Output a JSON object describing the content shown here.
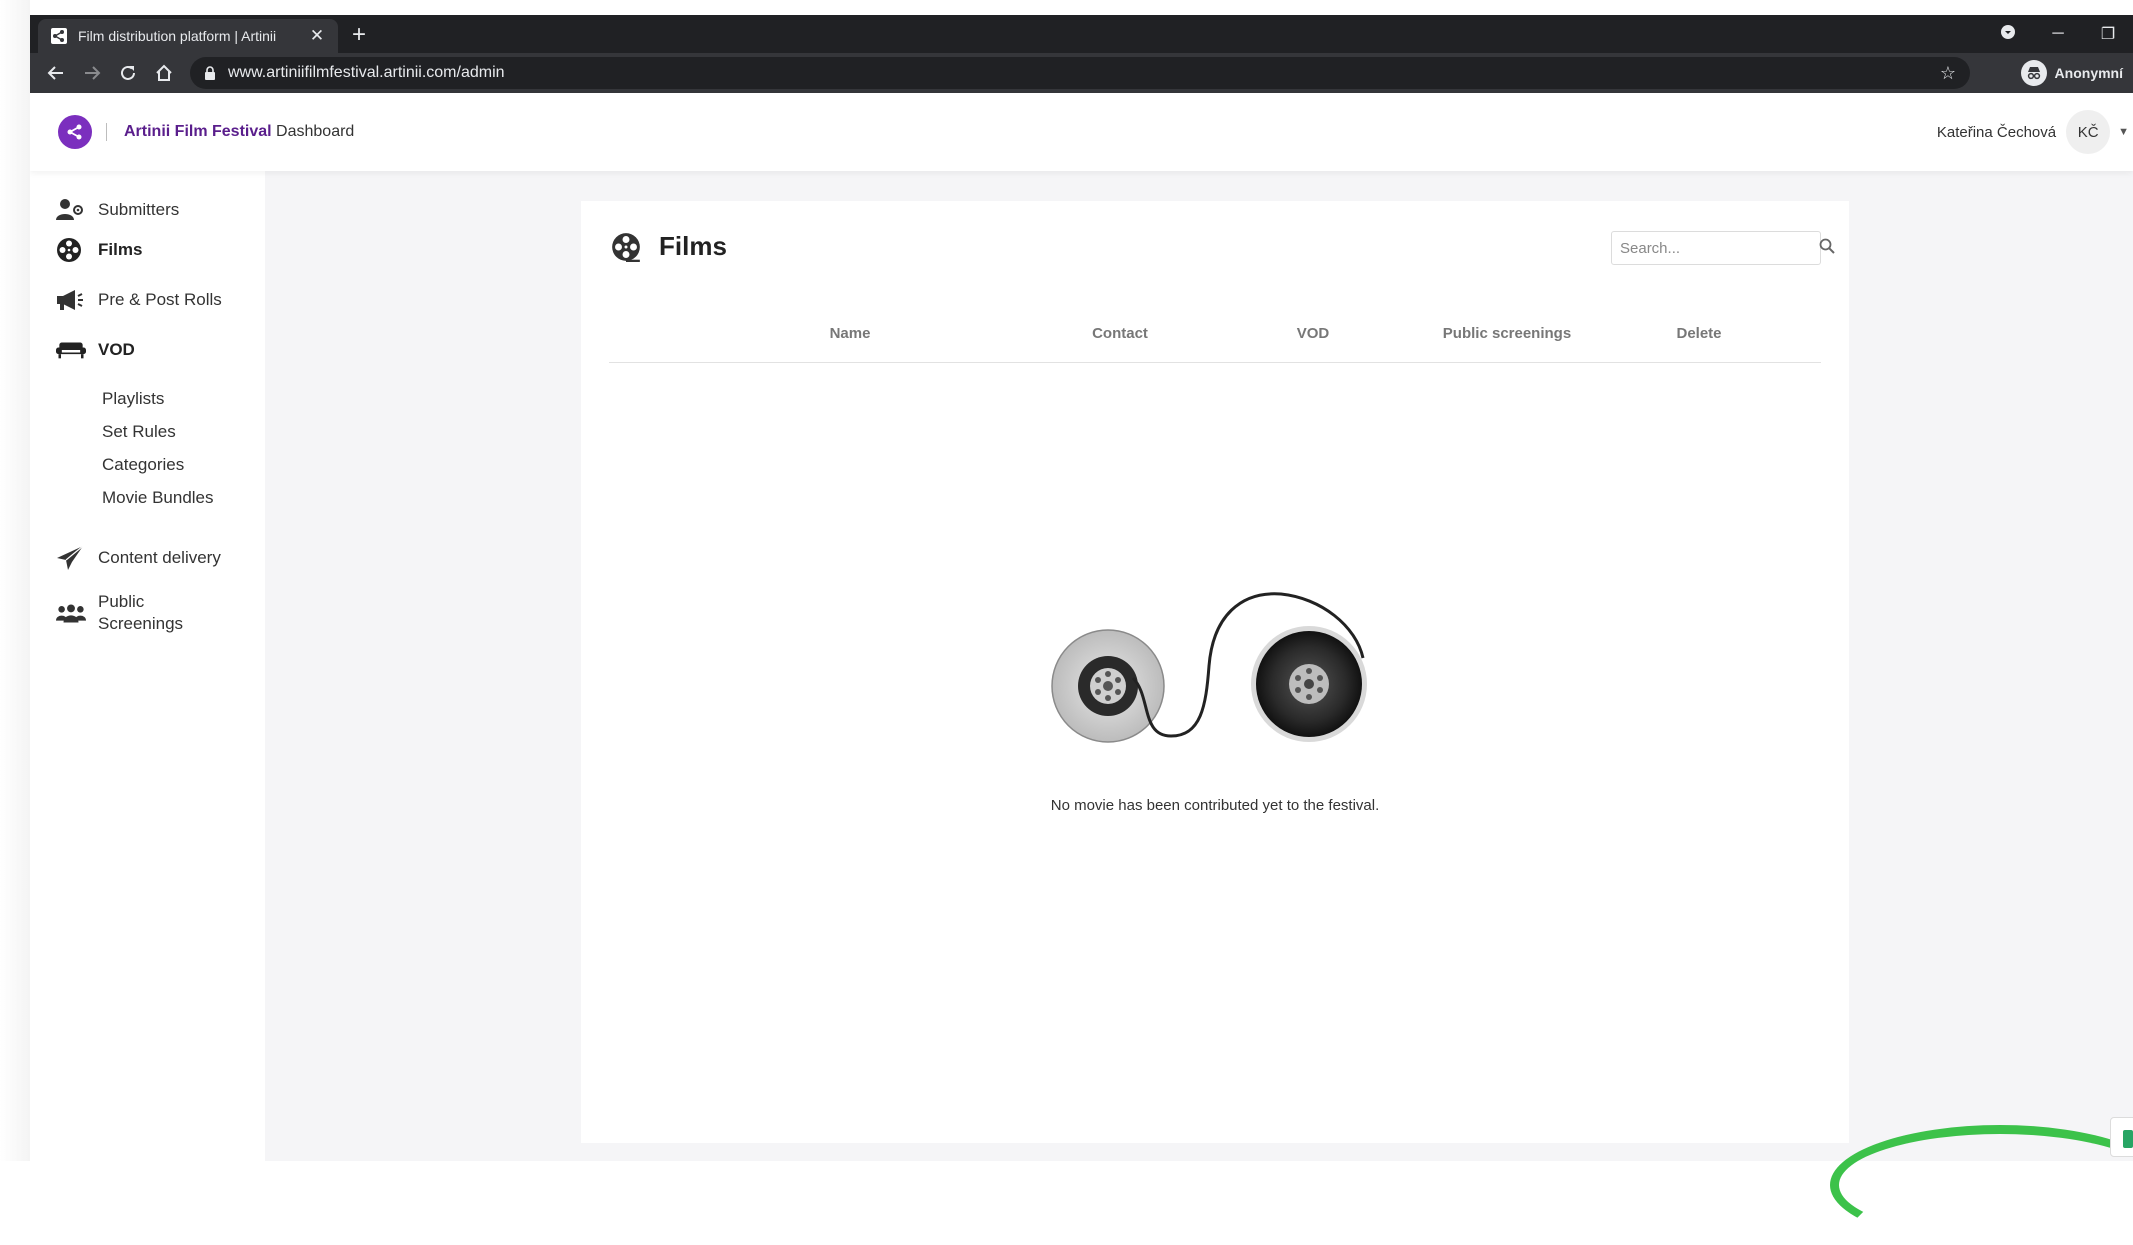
{
  "browser": {
    "tab_title": "Film distribution platform | Artinii",
    "tab_close": "✕",
    "new_tab": "+",
    "url": "www.artiniifilmfestival.artinii.com/admin",
    "profile_label": "Anonymní"
  },
  "header": {
    "brand_name": "Artinii Film Festival",
    "brand_suffix": "Dashboard",
    "user_name": "Kateřina Čechová",
    "user_initials": "KČ"
  },
  "sidebar": {
    "items": [
      {
        "label": "Submitters",
        "icon": "user-cog-icon"
      },
      {
        "label": "Films",
        "icon": "film-reel-icon",
        "active": true
      },
      {
        "label": "Pre & Post Rolls",
        "icon": "megaphone-icon"
      },
      {
        "label": "VOD",
        "icon": "couch-icon",
        "active": true
      },
      {
        "label": "Content delivery",
        "icon": "paper-plane-icon"
      },
      {
        "label": "Public Screenings",
        "icon": "users-icon"
      }
    ],
    "vod_subitems": [
      "Playlists",
      "Set Rules",
      "Categories",
      "Movie Bundles"
    ],
    "public_screenings_line1": "Public",
    "public_screenings_line2": "Screenings"
  },
  "main": {
    "title": "Films",
    "search_placeholder": "Search...",
    "columns": [
      "Name",
      "Contact",
      "VOD",
      "Public screenings",
      "Delete"
    ],
    "empty_message": "No movie has been contributed yet to the festival."
  },
  "colors": {
    "brand_purple": "#7b2fbe",
    "brand_text": "#5a1e8c",
    "background": "#f5f5f7"
  }
}
